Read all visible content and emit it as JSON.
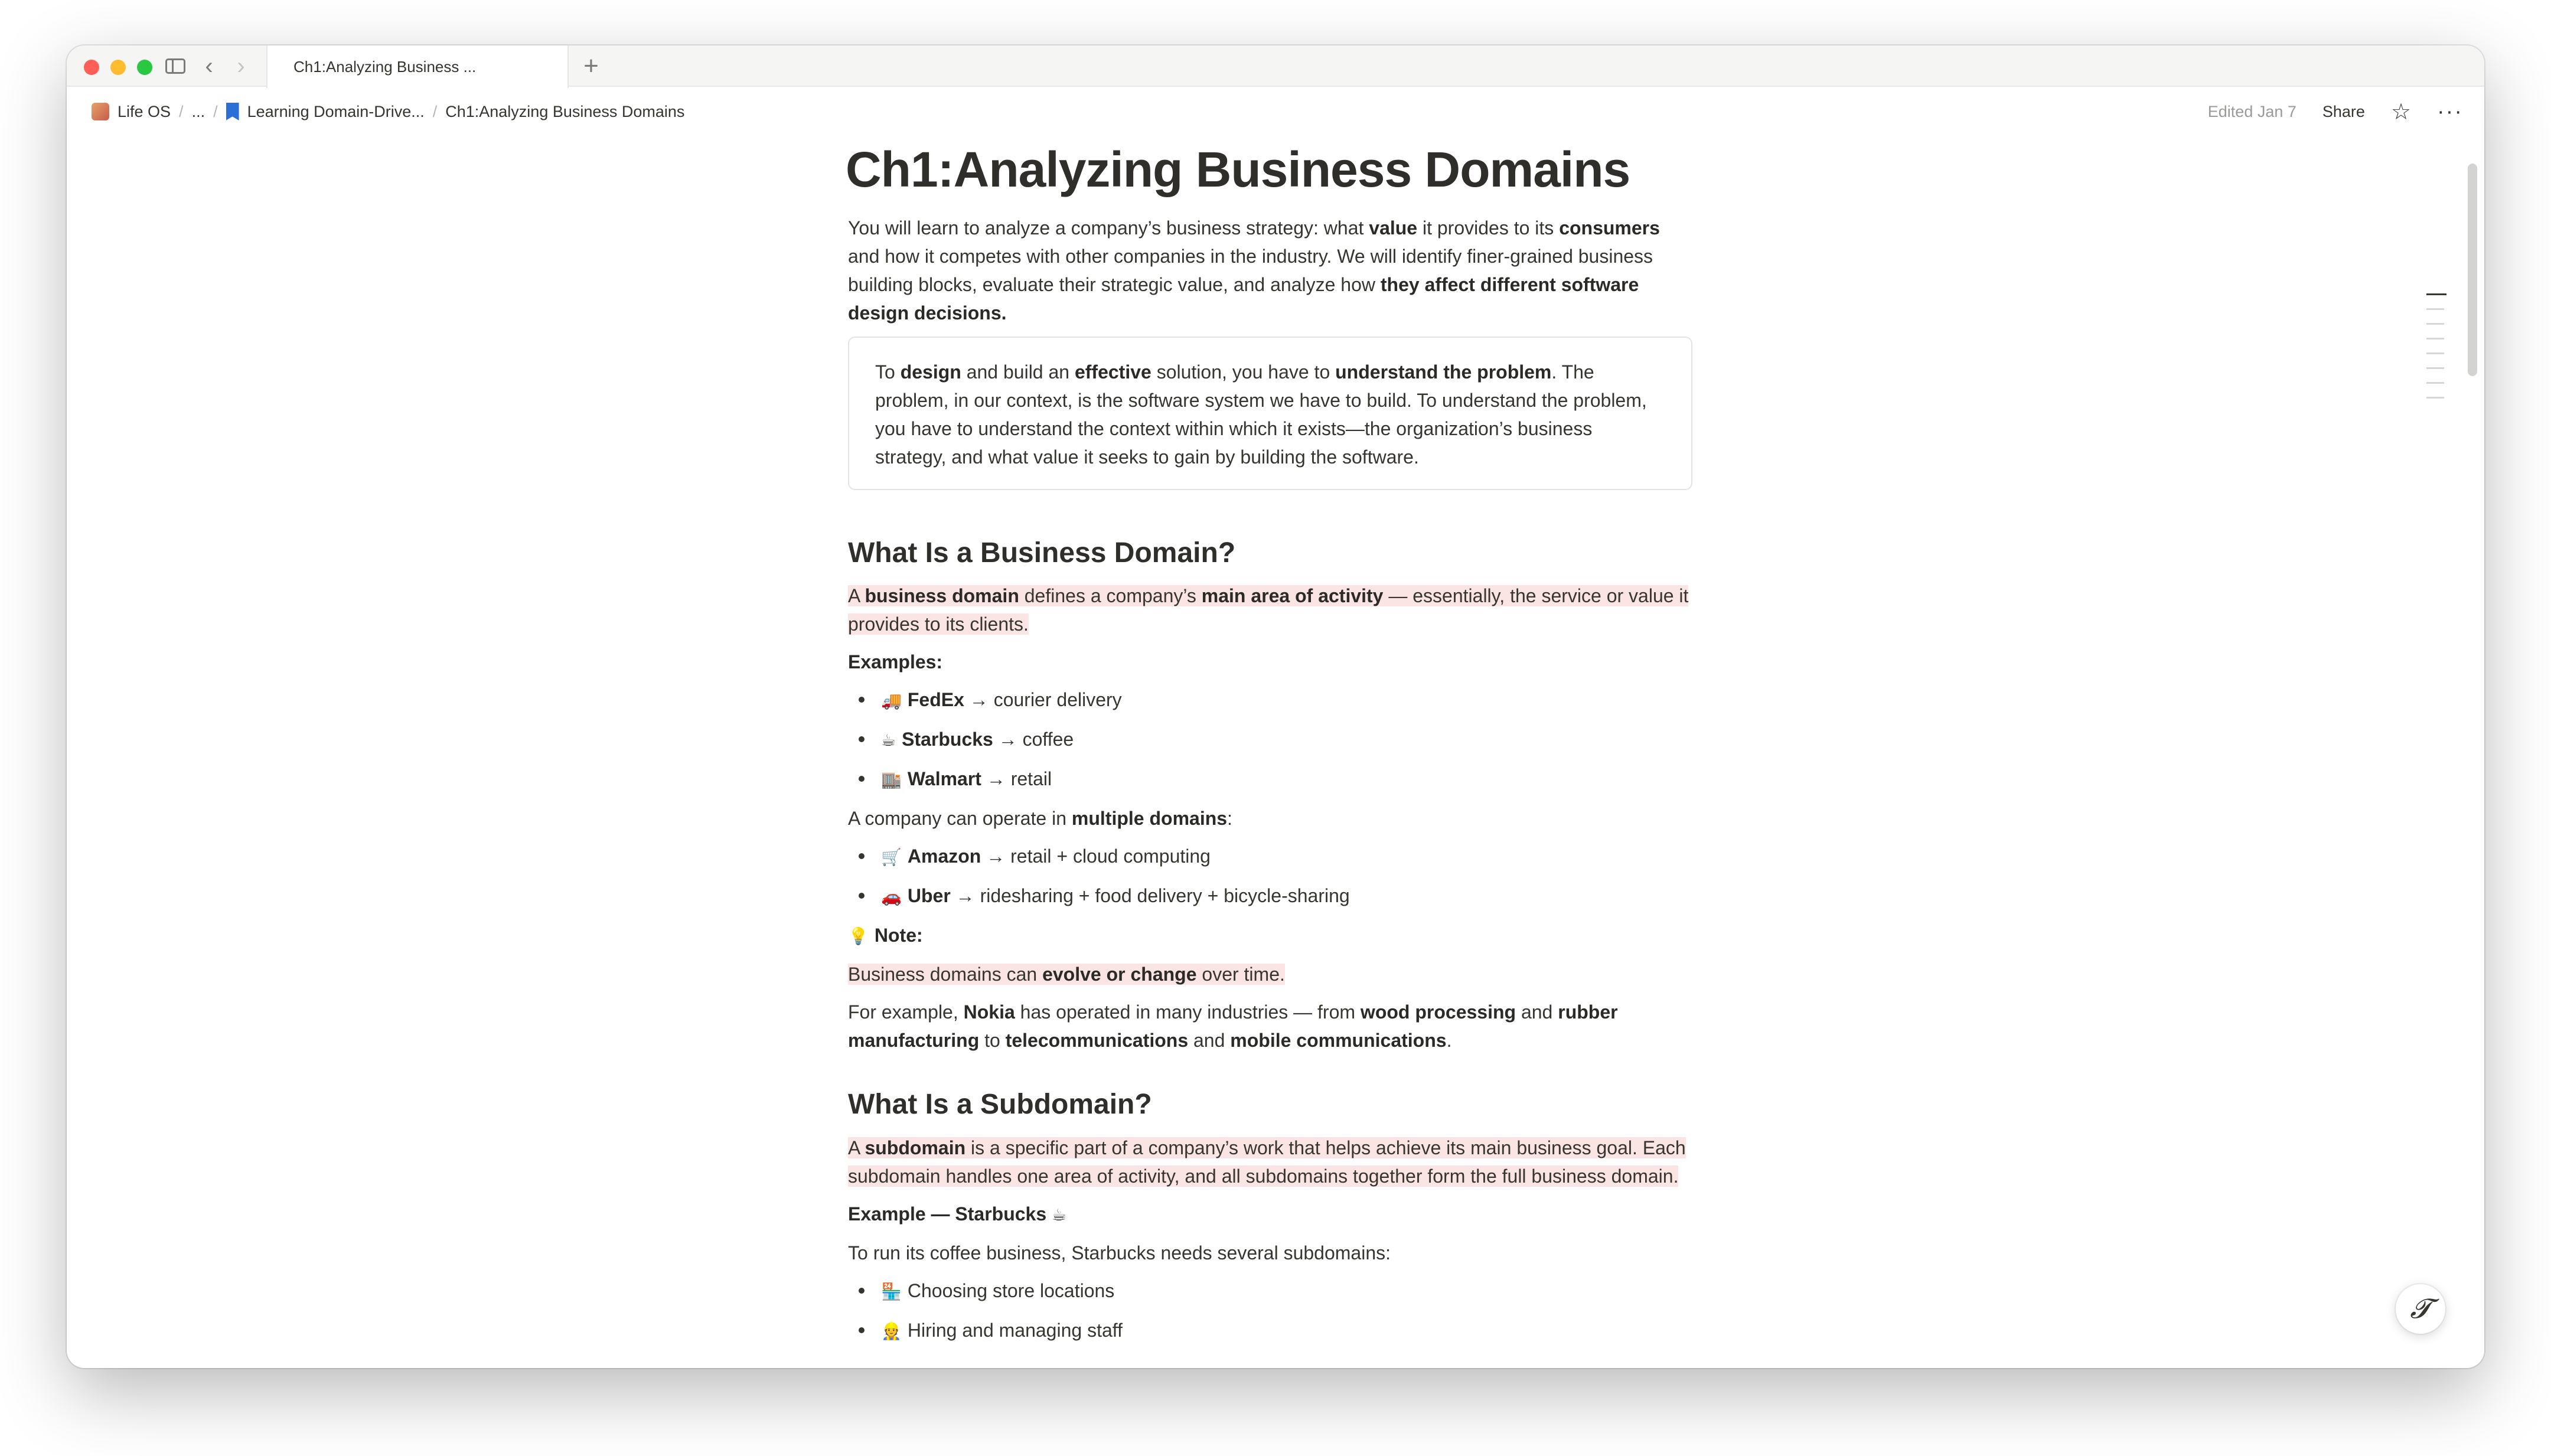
{
  "browser": {
    "tab_title": "Ch1:Analyzing Business ...",
    "new_tab_label": "+"
  },
  "breadcrumb": {
    "workspace": "Life OS",
    "ellipsis": "...",
    "parent": "Learning Domain-Drive...",
    "current": "Ch1:Analyzing Business Domains"
  },
  "topbar": {
    "edited": "Edited Jan 7",
    "share": "Share"
  },
  "page": {
    "title": "Ch1:Analyzing Business Domains",
    "intro": [
      {
        "t": "You will learn to analyze a company’s business strategy: what "
      },
      {
        "t": "value",
        "b": true
      },
      {
        "t": " it provides to its "
      },
      {
        "t": "consumers",
        "b": true
      },
      {
        "t": " and how it competes with other companies in the industry. We will identify finer-grained business building blocks, evaluate their strategic value, and analyze how "
      },
      {
        "t": "they affect different software design decisions.",
        "b": true
      }
    ],
    "callout": [
      {
        "t": "To "
      },
      {
        "t": "design",
        "b": true
      },
      {
        "t": " and build an "
      },
      {
        "t": "effective",
        "b": true
      },
      {
        "t": " solution, you have to "
      },
      {
        "t": "understand the problem",
        "b": true
      },
      {
        "t": ". The problem, in our context, is the software system we have to build. To understand the problem, you have to understand the context within which it exists—the organization’s business strategy, and what value it seeks to gain by building the software."
      }
    ],
    "section1": {
      "heading": "What Is a Business Domain?",
      "definition": [
        {
          "t": "A "
        },
        {
          "t": "business domain",
          "b": true
        },
        {
          "t": " defines a company’s "
        },
        {
          "t": "main area of activity",
          "b": true
        },
        {
          "t": " — essentially, the service or value it provides to its clients."
        }
      ],
      "examples_label": "Examples:",
      "examples": [
        {
          "emoji": "🚚",
          "name": "FedEx",
          "rest": " → courier delivery"
        },
        {
          "emoji": "☕",
          "name": "Starbucks",
          "rest": " → coffee"
        },
        {
          "emoji": "🏬",
          "name": "Walmart",
          "rest": " → retail"
        }
      ],
      "multi": [
        {
          "t": "A company can operate in "
        },
        {
          "t": "multiple domains",
          "b": true
        },
        {
          "t": ":"
        }
      ],
      "multi_examples": [
        {
          "emoji": "🛒",
          "name": "Amazon",
          "rest": " → retail + cloud computing"
        },
        {
          "emoji": "🚗",
          "name": "Uber",
          "rest": " → ridesharing + food delivery + bicycle-sharing"
        }
      ],
      "note_emoji": "💡",
      "note_label": "Note:",
      "evolve": [
        {
          "t": "Business domains can "
        },
        {
          "t": "evolve or change",
          "b": true
        },
        {
          "t": " over time."
        }
      ],
      "nokia": [
        {
          "t": "For example, "
        },
        {
          "t": "Nokia",
          "b": true
        },
        {
          "t": " has operated in many industries — from "
        },
        {
          "t": "wood processing",
          "b": true
        },
        {
          "t": " and "
        },
        {
          "t": "rubber manufacturing",
          "b": true
        },
        {
          "t": " to "
        },
        {
          "t": "telecommunications",
          "b": true
        },
        {
          "t": " and "
        },
        {
          "t": "mobile communications",
          "b": true
        },
        {
          "t": "."
        }
      ]
    },
    "section2": {
      "heading": "What Is a Subdomain?",
      "definition": [
        {
          "t": "A "
        },
        {
          "t": "subdomain",
          "b": true
        },
        {
          "t": " is a specific part of a company’s work that helps achieve its main business goal. Each subdomain handles one area of activity, and all subdomains together form the full business domain."
        }
      ],
      "example_label": "Example — Starbucks",
      "example_emoji": "☕",
      "intro_line": "To run its coffee business, Starbucks needs several subdomains:",
      "items": [
        {
          "emoji": "🏪",
          "text": "Choosing store locations"
        },
        {
          "emoji": "👷",
          "text": "Hiring and managing staff"
        }
      ]
    }
  },
  "icons": {
    "help": "𝓣"
  }
}
